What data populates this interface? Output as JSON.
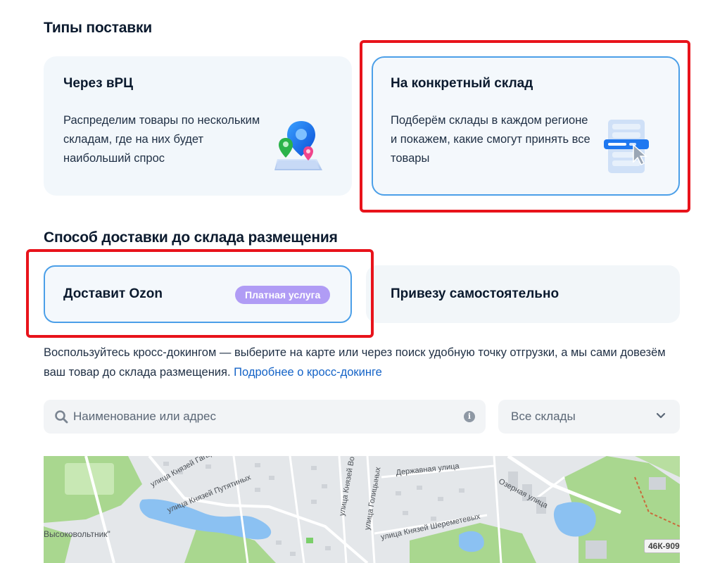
{
  "section_types": {
    "title": "Типы поставки",
    "cards": [
      {
        "title": "Через вРЦ",
        "description": "Распределим товары по нескольким складам, где на них будет наибольший спрос"
      },
      {
        "title": "На конкретный склад",
        "description": "Подберём склады в каждом регионе и покажем, какие смогут принять все товары"
      }
    ]
  },
  "section_delivery": {
    "title": "Способ доставки до склада размещения",
    "options": [
      {
        "label": "Доставит Ozon",
        "badge": "Платная услуга"
      },
      {
        "label": "Привезу самостоятельно"
      }
    ],
    "info_text": "Воспользуйтесь кросс-докингом — выберите на карте или через поиск удобную точку отгрузки, а мы сами довезём ваш товар до склада размещения.",
    "info_link": "Подробнее о кросс-докинге"
  },
  "search": {
    "placeholder": "Наименование или адрес"
  },
  "warehouse_select": {
    "value": "Все склады"
  },
  "map": {
    "labels": [
      "улица Князей Гагариных",
      "улица Князей Путятиных",
      "Высоковольтник\"",
      "улица Князей Во",
      "улица Голицыных",
      "Державная улица",
      "улица Князей Шереметевых",
      "Озерная улица"
    ],
    "road_badge": "46К-909"
  },
  "colors": {
    "accent_border": "#4b9fe8",
    "highlight_frame": "#e8131b",
    "badge_bg": "#b09cf5",
    "link": "#1463c7"
  }
}
